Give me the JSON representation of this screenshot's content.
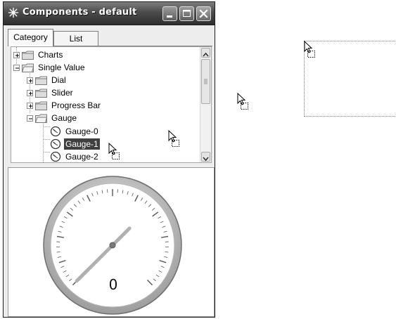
{
  "window": {
    "title": "Components - default",
    "controls": {
      "minimize": "minimize",
      "maximize": "maximize",
      "close": "close"
    }
  },
  "tabs": [
    {
      "label": "Category",
      "active": true
    },
    {
      "label": "List",
      "active": false
    }
  ],
  "tree": {
    "items": [
      {
        "label": "Charts",
        "expander": "+",
        "icon": "folder-icon"
      },
      {
        "label": "Single Value",
        "expander": "-",
        "icon": "folder-icon"
      },
      {
        "label": "Dial",
        "expander": "+",
        "icon": "folder-icon"
      },
      {
        "label": "Slider",
        "expander": "+",
        "icon": "folder-icon"
      },
      {
        "label": "Progress Bar",
        "expander": "+",
        "icon": "folder-icon"
      },
      {
        "label": "Gauge",
        "expander": "-",
        "icon": "folder-icon"
      },
      {
        "label": "Gauge-0",
        "icon": "gauge-icon"
      },
      {
        "label": "Gauge-1",
        "icon": "gauge-icon",
        "selected": true
      },
      {
        "label": "Gauge-2",
        "icon": "gauge-icon"
      }
    ]
  },
  "preview": {
    "gauge_value": "0",
    "gauge_needle_value": 0
  },
  "colors": {
    "titlebar": "#4b4b4b",
    "selection": "#3f3f3f",
    "needle": "#b9b9b9"
  }
}
